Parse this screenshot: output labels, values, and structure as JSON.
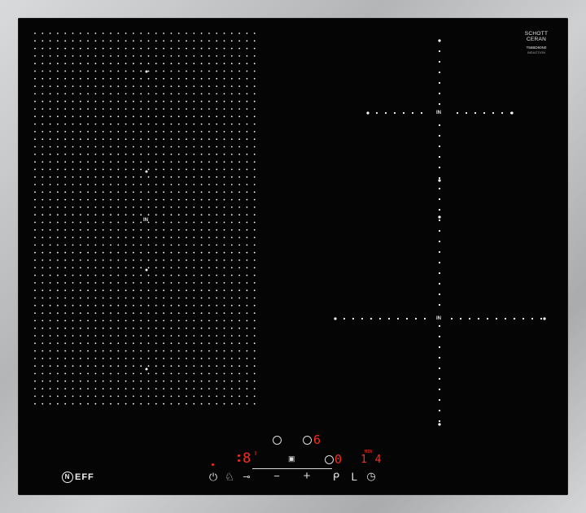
{
  "panel": {
    "glass_brand_top": "SCHOTT",
    "glass_brand_bottom": "CERAN",
    "model": "T56BD50N0",
    "model_sub": "INDUCTION"
  },
  "zones": {
    "flex_zone_label": "IN",
    "right_top_label": "IN",
    "right_bottom_label": "IN"
  },
  "brand": "EFF",
  "brand_initial": "N",
  "controls": {
    "left_display": "8",
    "flex_power_display": "6",
    "right_display": "0",
    "timer_display": "1 4",
    "timer_unit": "MIN",
    "minus_label": "−",
    "plus_label": "+",
    "icons": [
      "power-icon",
      "childlock-icon",
      "key-icon",
      "minus-icon",
      "plus-icon",
      "powerboost-icon",
      "sensor-icon",
      "timer-icon",
      "wipe-protection-icon"
    ]
  },
  "colors": {
    "glass": "#050505",
    "frame": "#c1c2c3",
    "display_red": "#ff2a1e",
    "dots": "#ffffff"
  }
}
